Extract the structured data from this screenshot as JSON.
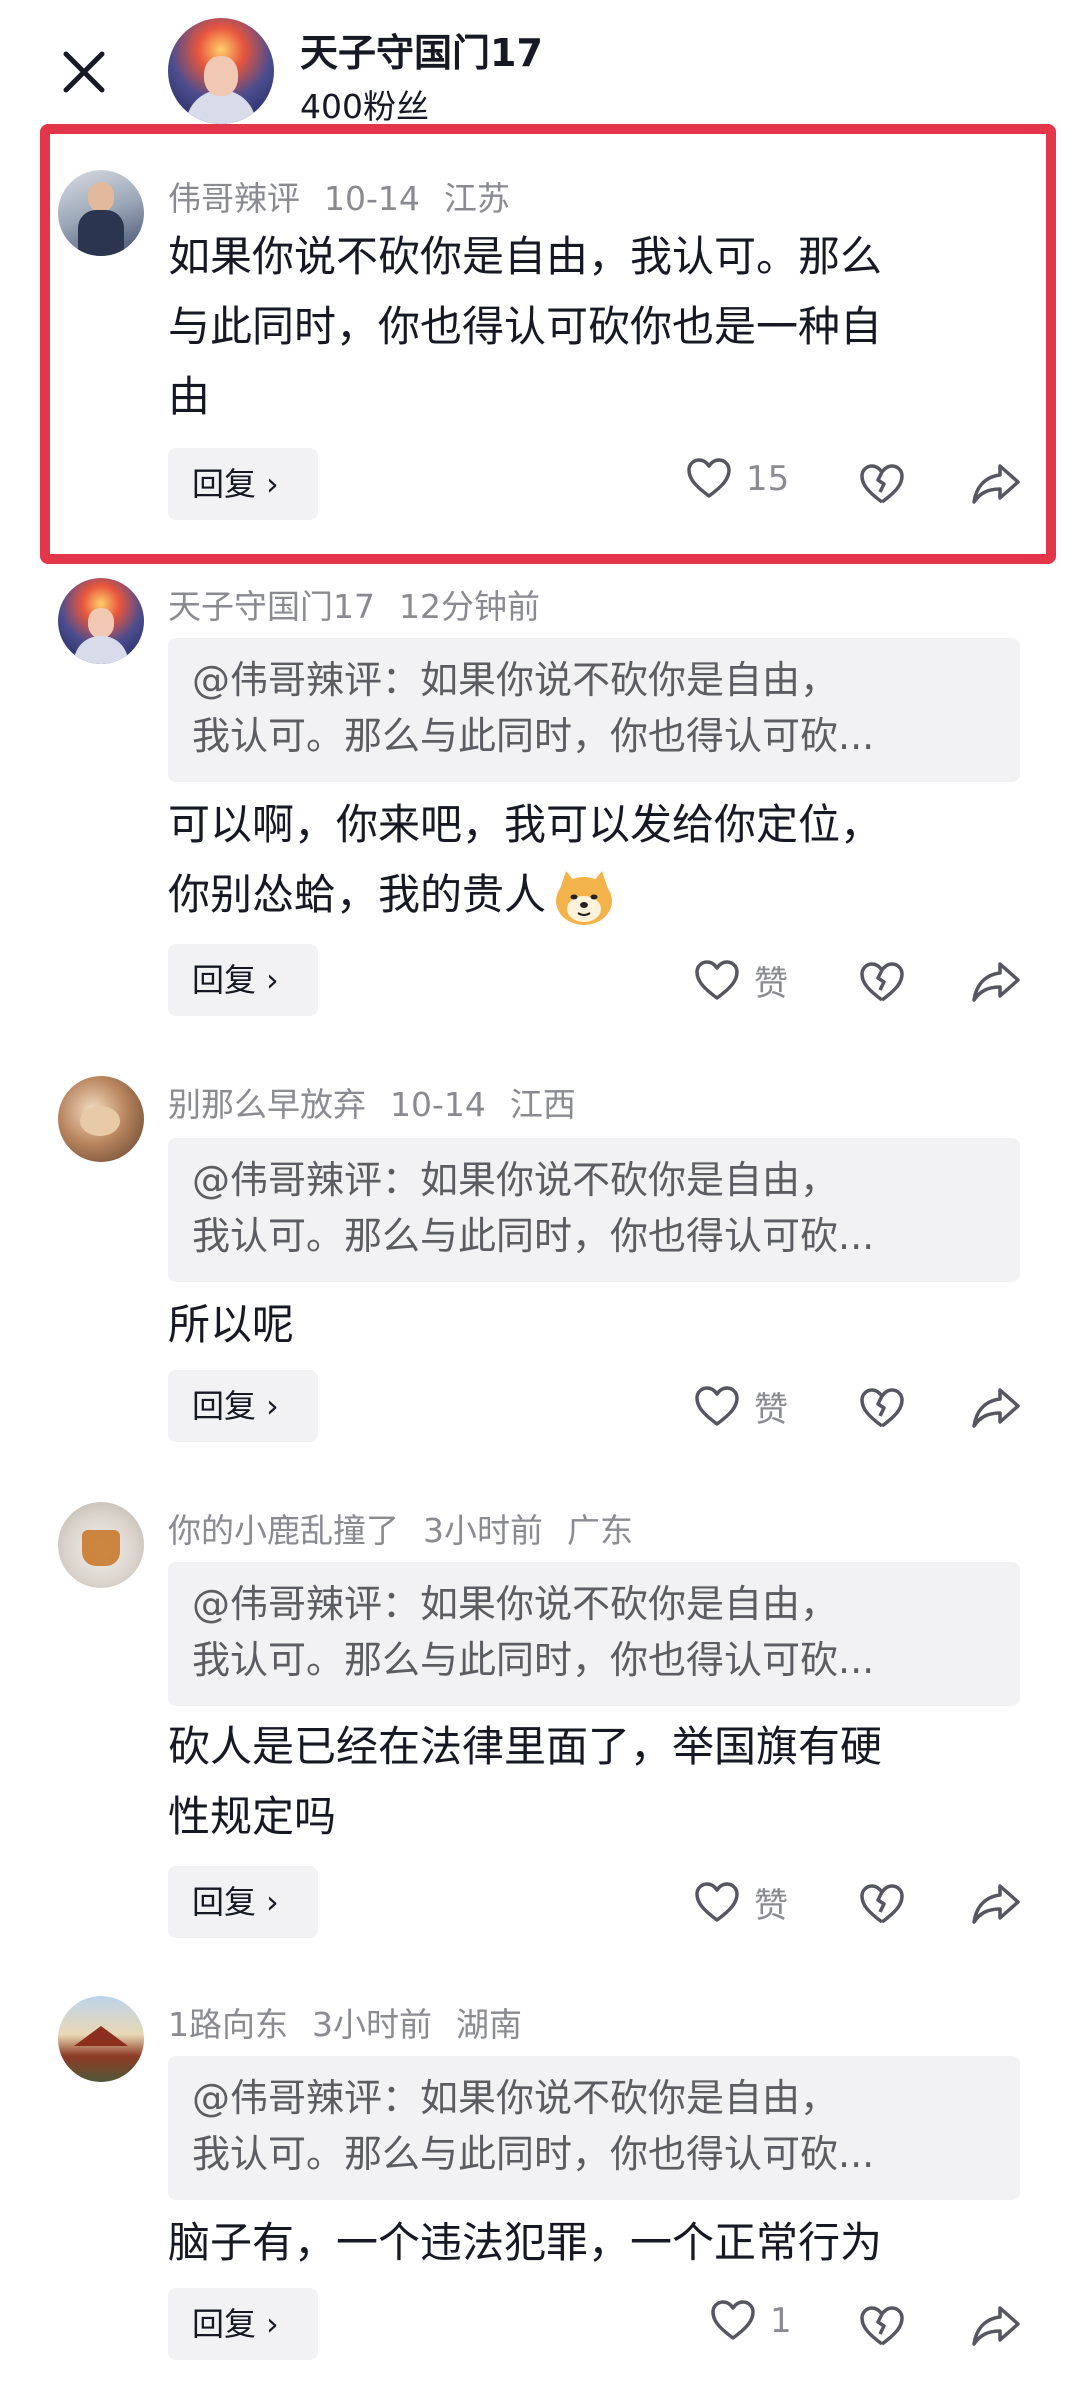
{
  "header": {
    "close_icon": "close-icon",
    "name": "天子守国门17",
    "fans": "400粉丝"
  },
  "comments": [
    {
      "user": "伟哥辣评",
      "time": "10-14",
      "location": "江苏",
      "lines": [
        "如果你说不砍你是自由，我认可。那么",
        "与此同时，你也得认可砍你也是一种自",
        "由"
      ],
      "reply_label": "回复",
      "like_label": "15",
      "highlighted": true
    },
    {
      "user": "天子守国门17",
      "time": "12分钟前",
      "location": "",
      "quote_lines": [
        "@伟哥辣评：如果你说不砍你是自由，",
        "我认可。那么与此同时，你也得认可砍..."
      ],
      "lines": [
        "可以啊，你来吧，我可以发给你定位，",
        "你别怂蛤，我的贵人"
      ],
      "emoji": "doge-emoji",
      "reply_label": "回复",
      "like_label": "赞"
    },
    {
      "user": "别那么早放弃",
      "time": "10-14",
      "location": "江西",
      "quote_lines": [
        "@伟哥辣评：如果你说不砍你是自由，",
        "我认可。那么与此同时，你也得认可砍..."
      ],
      "lines": [
        "所以呢"
      ],
      "reply_label": "回复",
      "like_label": "赞"
    },
    {
      "user": "你的小鹿乱撞了",
      "time": "3小时前",
      "location": "广东",
      "quote_lines": [
        "@伟哥辣评：如果你说不砍你是自由，",
        "我认可。那么与此同时，你也得认可砍..."
      ],
      "lines": [
        "砍人是已经在法律里面了，举国旗有硬",
        "性规定吗"
      ],
      "reply_label": "回复",
      "like_label": "赞"
    },
    {
      "user": "1路向东",
      "time": "3小时前",
      "location": "湖南",
      "quote_lines": [
        "@伟哥辣评：如果你说不砍你是自由，",
        "我认可。那么与此同时，你也得认可砍..."
      ],
      "lines": [
        "脑子有，一个违法犯罪，一个正常行为"
      ],
      "reply_label": "回复",
      "like_label": "1"
    }
  ],
  "colors": {
    "highlight": "#e3364a",
    "meta_text": "#8a8b91",
    "quote_bg": "#f2f2f4"
  }
}
